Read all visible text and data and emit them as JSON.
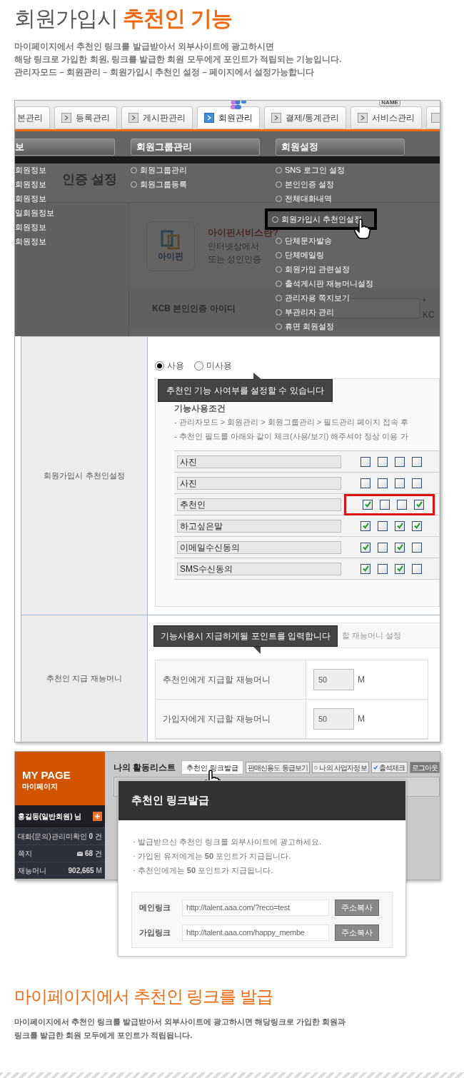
{
  "header": {
    "title": "회원가입시",
    "title_highlight": "추천인 기능",
    "description": [
      "마이페이지에서 추천인 링크를 발급받아서 외부사이트에 광고하시면",
      "해당 링크로 가입한 회원, 링크를 발급한 회원 모두에게 포인트가 적립되는 기능입니다.",
      "관리자모드 – 회원관리 – 회원가입시 추천인 설정 – 페이지에서 설정가능합니다"
    ]
  },
  "admin": {
    "tabs": [
      {
        "label": "본관리",
        "selected": false
      },
      {
        "label": "등록관리",
        "selected": false
      },
      {
        "label": "게시판관리",
        "selected": false
      },
      {
        "label": "회원관리",
        "selected": true,
        "kind": "people"
      },
      {
        "label": "결제/통계관리",
        "selected": false
      },
      {
        "label": "서비스관리",
        "selected": false,
        "badge": "NAME"
      }
    ],
    "menu": [
      {
        "header": "보",
        "items": [
          {
            "label": "회원정보",
            "selected": false
          },
          {
            "label": "회원정보",
            "selected": false
          },
          {
            "label": "회원정보",
            "selected": false
          },
          {
            "label": "일회원정보",
            "selected": false
          },
          {
            "label": "회원정보",
            "selected": false
          },
          {
            "label": "회원정보",
            "selected": false
          }
        ]
      },
      {
        "header": "회원그룹관리",
        "items": [
          {
            "label": "회원그룹관리",
            "selected": false
          },
          {
            "label": "회원그룹등록",
            "selected": false
          }
        ]
      },
      {
        "header": "회원설정",
        "items": [
          {
            "label": "SNS 로그인 설정",
            "selected": false
          },
          {
            "label": "본인인증 설정",
            "selected": false
          },
          {
            "label": "전체대화내역",
            "selected": false
          },
          {
            "label": "회원가입시 추천인설정",
            "selected": true
          },
          {
            "label": "단체문자발송",
            "selected": false
          },
          {
            "label": "단체메일링",
            "selected": false
          },
          {
            "label": "회원가입 관련설정",
            "selected": false
          },
          {
            "label": "출석게시판 재능머니설정",
            "selected": false
          },
          {
            "label": "관리자용 쪽지보기",
            "selected": false
          },
          {
            "label": "부관리자 관리",
            "selected": false
          },
          {
            "label": "휴면 회원설정",
            "selected": false
          }
        ]
      }
    ],
    "page": {
      "title": "인증 설정",
      "logo_text": "아이핀",
      "ipin_heading": "아이핀서비스란?",
      "ipin_lines": [
        "인터넷상에서",
        "또는 성인인증"
      ],
      "kcb_label": "KCB 본인인증 아이디",
      "kcb_note": "* KC"
    },
    "recommend": {
      "label": "회원가입시 추천인설정",
      "options": [
        {
          "label": "사용",
          "selected": true
        },
        {
          "label": "미사용",
          "selected": false
        }
      ],
      "tooltip": "추천인 기능 사여부를 설정할 수 있습니다",
      "conditions_title": "기능사용조건",
      "conditions": [
        "- 관리자모드 > 회원관리 > 회원그룹관리 > 필드관리 페이지 접속 후",
        "- 추천인 필드를 아래와 같이 체크(사용/보기) 해주셔야 정상 이용 가"
      ],
      "fields": [
        {
          "label": "사진",
          "highlighted": false,
          "checks": [
            {
              "checked": false
            },
            {
              "checked": false
            },
            {
              "checked": false
            },
            {
              "checked": false
            }
          ]
        },
        {
          "label": "사진",
          "highlighted": false,
          "checks": [
            {
              "checked": false
            },
            {
              "checked": false
            },
            {
              "checked": false
            },
            {
              "checked": false
            }
          ]
        },
        {
          "label": "추천인",
          "highlighted": true,
          "checks": [
            {
              "checked": true
            },
            {
              "checked": false
            },
            {
              "checked": false
            },
            {
              "checked": true
            }
          ]
        },
        {
          "label": "하고싶은말",
          "highlighted": false,
          "checks": [
            {
              "checked": true
            },
            {
              "checked": false
            },
            {
              "checked": true
            },
            {
              "checked": true
            }
          ]
        },
        {
          "label": "이메일수신동의",
          "highlighted": false,
          "checks": [
            {
              "checked": true
            },
            {
              "checked": false
            },
            {
              "checked": true
            },
            {
              "checked": false
            }
          ]
        },
        {
          "label": "SMS수신동의",
          "highlighted": false,
          "checks": [
            {
              "checked": true
            },
            {
              "checked": false
            },
            {
              "checked": true
            },
            {
              "checked": false
            }
          ]
        }
      ]
    },
    "money": {
      "label": "추천인 지급 재능머니",
      "tooltip": "기능사용시 지급하게될 포인트를 입력합니다",
      "strip_text": "할 재능머니 설정",
      "rows": [
        {
          "label": "추천인에게 지급할 재능머니",
          "value": "50",
          "unit": "M"
        },
        {
          "label": "가입자에게 지급할 재능머니",
          "value": "50",
          "unit": "M"
        }
      ]
    }
  },
  "mypage": {
    "brand": "MY PAGE",
    "brand_sub": "마이페이지",
    "user": "홍길동(일반회원) 님",
    "stats": [
      {
        "label": "대화(문의)관리",
        "value": "미확인 **0** 건",
        "kind": "plain"
      },
      {
        "label": "쪽지",
        "value": "**68** 건",
        "kind": "mail"
      },
      {
        "label": "재능머니",
        "value": "**902,665** M",
        "kind": "plain"
      }
    ],
    "title": "나의 활동리스트",
    "primary_button": "추천인 링크발급",
    "buttons": [
      {
        "label": "판매신용도 등급보기",
        "kind": "plain"
      },
      {
        "label": "나의 사업자정보",
        "kind": "dot"
      },
      {
        "label": "출석체크",
        "kind": "check"
      },
      {
        "label": "로그아웃",
        "kind": "dark"
      }
    ],
    "modal": {
      "title": "추천인 링크발급",
      "lines": [
        "· 발급받으신 추천인 링크를 외부사이트에 광고하세요.",
        "· 가입된 유저에게는 **50** 포인트가 지급됩니다.",
        "· 추천인에게는 **50** 포인트가 지급됩니다."
      ],
      "links": [
        {
          "label": "메인링크",
          "value": "http://talent.aaa.com/?reco=test",
          "button": "주소복사"
        },
        {
          "label": "가입링크",
          "value": "http://talent.aaa.com/happy_membe",
          "button": "주소복사"
        }
      ]
    }
  },
  "footer": {
    "title": "마이페이지에서 추천인 링크를 발급",
    "description": [
      "마이페이지에서 추천인 링크를 발급받아서 외부사이트에 광고하시면 해당링크로 가입한 회원과",
      "링크를 발급한 회원 모두에게 포인트가 적립됩니다."
    ]
  }
}
